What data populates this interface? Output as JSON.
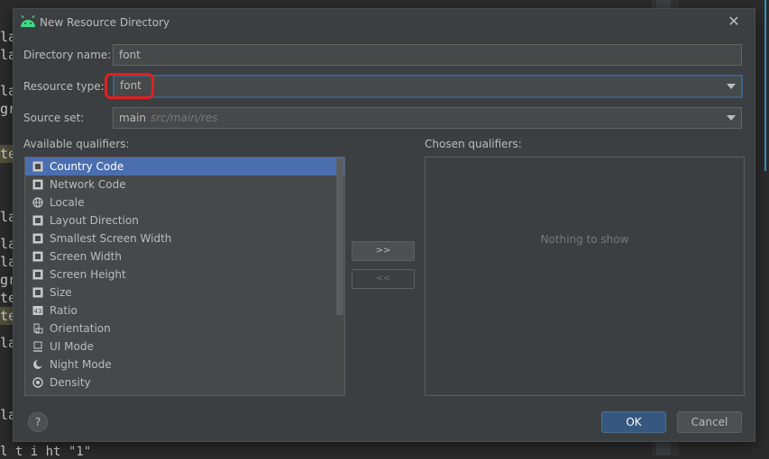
{
  "editor": {
    "fragments": [
      "la",
      "la",
      "la",
      "gr",
      "te",
      "la",
      "la",
      "la",
      "gr",
      "te",
      "te",
      "la",
      "la"
    ],
    "bottom_text": "l   t  i  ht  \"1\""
  },
  "dialog": {
    "title": "New Resource Directory",
    "close_glyph": "✕",
    "directory_name_label": "Directory name:",
    "directory_name_value": "font",
    "resource_type_label": "Resource type:",
    "resource_type_value": "font",
    "source_set_label": "Source set:",
    "source_set_value": "main",
    "source_set_path": "src/main/res",
    "available_label": "Available qualifiers:",
    "chosen_label": "Chosen qualifiers:",
    "qualifiers": [
      {
        "label": "Country Code",
        "icon": "country-code-icon",
        "selected": true
      },
      {
        "label": "Network Code",
        "icon": "network-code-icon"
      },
      {
        "label": "Locale",
        "icon": "globe-icon"
      },
      {
        "label": "Layout Direction",
        "icon": "layout-direction-icon"
      },
      {
        "label": "Smallest Screen Width",
        "icon": "smallest-width-icon"
      },
      {
        "label": "Screen Width",
        "icon": "screen-width-icon"
      },
      {
        "label": "Screen Height",
        "icon": "screen-height-icon"
      },
      {
        "label": "Size",
        "icon": "size-icon"
      },
      {
        "label": "Ratio",
        "icon": "ratio-icon"
      },
      {
        "label": "Orientation",
        "icon": "orientation-icon"
      },
      {
        "label": "UI Mode",
        "icon": "ui-mode-icon"
      },
      {
        "label": "Night Mode",
        "icon": "night-mode-icon"
      },
      {
        "label": "Density",
        "icon": "density-icon"
      }
    ],
    "add_button": ">>",
    "remove_button": "<<",
    "nothing_to_show": "Nothing to show",
    "help_glyph": "?",
    "ok_label": "OK",
    "cancel_label": "Cancel"
  },
  "colors": {
    "selection": "#4b6eaf",
    "ok_button": "#365880",
    "annotation": "#e02020",
    "android_green": "#3ddc84"
  }
}
